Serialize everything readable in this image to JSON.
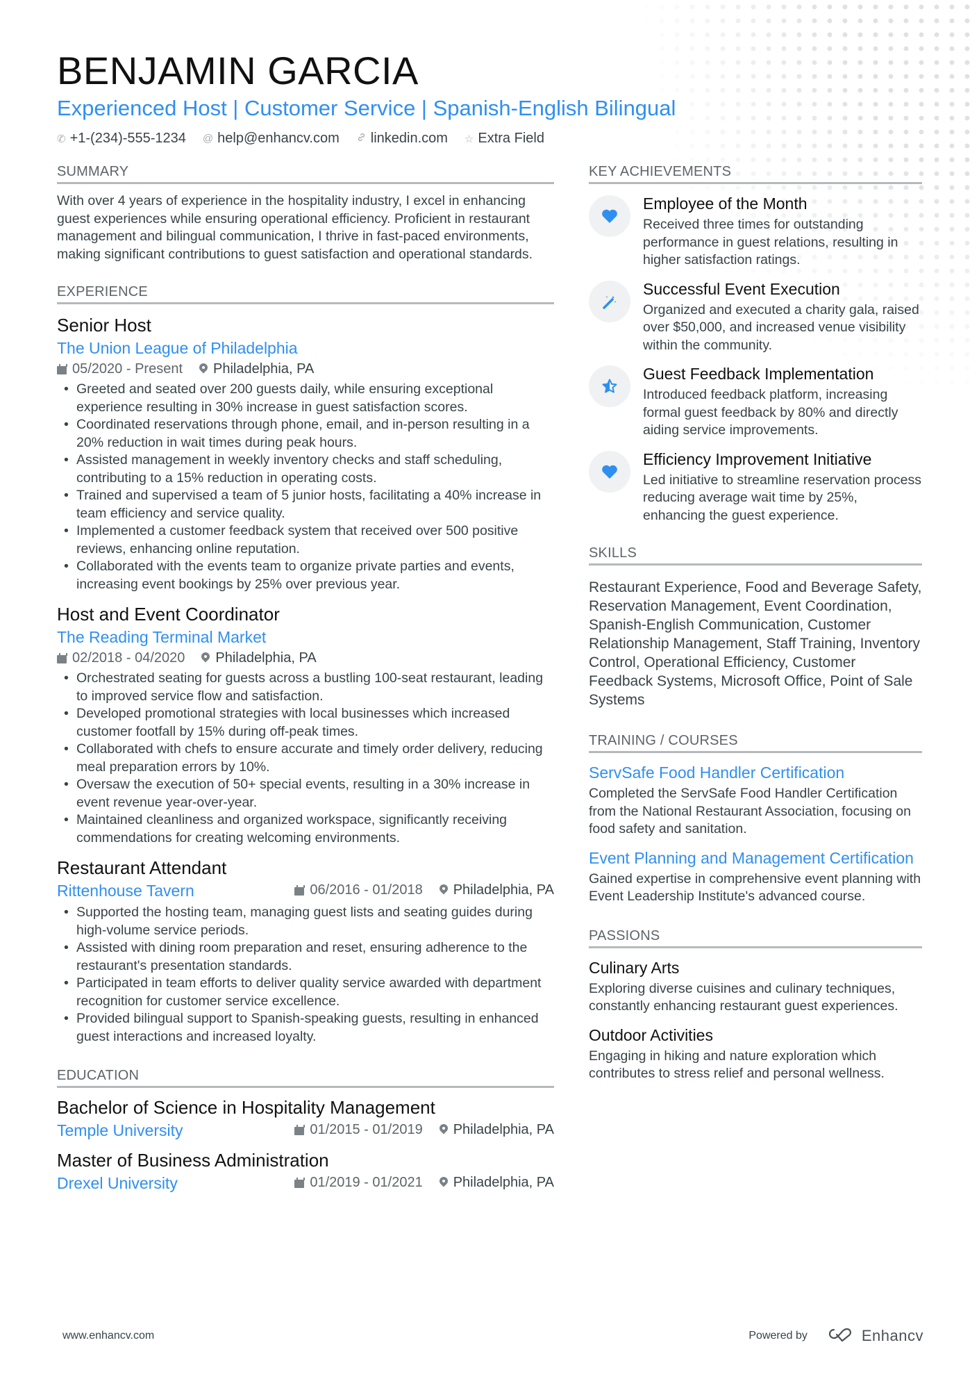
{
  "header": {
    "name": "BENJAMIN GARCIA",
    "title": "Experienced Host | Customer Service | Spanish-English Bilingual",
    "contacts": [
      {
        "icon": "phone-icon",
        "glyph": "✆",
        "text": "+1-(234)-555-1234"
      },
      {
        "icon": "at-icon",
        "glyph": "@",
        "text": "help@enhancv.com"
      },
      {
        "icon": "link-icon",
        "glyph": "🔗︎",
        "text": "linkedin.com"
      },
      {
        "icon": "star-icon",
        "glyph": "☆",
        "text": "Extra Field"
      }
    ]
  },
  "summary": {
    "heading": "SUMMARY",
    "text": "With over 4 years of experience in the hospitality industry, I excel in enhancing guest experiences while ensuring operational efficiency. Proficient in restaurant management and bilingual communication, I thrive in fast-paced environments, making significant contributions to guest satisfaction and operational standards."
  },
  "experience": {
    "heading": "EXPERIENCE",
    "jobs": [
      {
        "title": "Senior Host",
        "company": "The Union League of Philadelphia",
        "dates": "05/2020 - Present",
        "location": "Philadelphia, PA",
        "bullets": [
          "Greeted and seated over 200 guests daily, while ensuring exceptional experience resulting in 30% increase in guest satisfaction scores.",
          "Coordinated reservations through phone, email, and in-person resulting in a 20% reduction in wait times during peak hours.",
          "Assisted management in weekly inventory checks and staff scheduling, contributing to a 15% reduction in operating costs.",
          "Trained and supervised a team of 5 junior hosts, facilitating a 40% increase in team efficiency and service quality.",
          "Implemented a customer feedback system that received over 500 positive reviews, enhancing online reputation.",
          "Collaborated with the events team to organize private parties and events, increasing event bookings by 25% over previous year."
        ]
      },
      {
        "title": "Host and Event Coordinator",
        "company": "The Reading Terminal Market",
        "dates": "02/2018 - 04/2020",
        "location": "Philadelphia, PA",
        "bullets": [
          "Orchestrated seating for guests across a bustling 100-seat restaurant, leading to improved service flow and satisfaction.",
          "Developed promotional strategies with local businesses which increased customer footfall by 15% during off-peak times.",
          "Collaborated with chefs to ensure accurate and timely order delivery, reducing meal preparation errors by 10%.",
          "Oversaw the execution of 50+ special events, resulting in a 30% increase in event revenue year-over-year.",
          "Maintained cleanliness and organized workspace, significantly receiving commendations for creating welcoming environments."
        ]
      },
      {
        "title": "Restaurant Attendant",
        "company": "Rittenhouse Tavern",
        "dates": "06/2016 - 01/2018",
        "location": "Philadelphia, PA",
        "bullets": [
          "Supported the hosting team, managing guest lists and seating guides during high-volume service periods.",
          "Assisted with dining room preparation and reset, ensuring adherence to the restaurant's presentation standards.",
          "Participated in team efforts to deliver quality service awarded with department recognition for customer service excellence.",
          "Provided bilingual support to Spanish-speaking guests, resulting in enhanced guest interactions and increased loyalty."
        ]
      }
    ]
  },
  "education": {
    "heading": "EDUCATION",
    "items": [
      {
        "degree": "Bachelor of Science in Hospitality Management",
        "school": "Temple University",
        "dates": "01/2015 - 01/2019",
        "location": "Philadelphia, PA"
      },
      {
        "degree": "Master of Business Administration",
        "school": "Drexel University",
        "dates": "01/2019 - 01/2021",
        "location": "Philadelphia, PA"
      }
    ]
  },
  "achievements": {
    "heading": "KEY ACHIEVEMENTS",
    "items": [
      {
        "icon": "heart-icon",
        "glyph": "♥",
        "title": "Employee of the Month",
        "desc": "Received three times for outstanding performance in guest relations, resulting in higher satisfaction ratings."
      },
      {
        "icon": "magic-wand-icon",
        "glyph": "✎",
        "title": "Successful Event Execution",
        "desc": "Organized and executed a charity gala, raised over $50,000, and increased venue visibility within the community."
      },
      {
        "icon": "half-star-icon",
        "glyph": "☆",
        "title": "Guest Feedback Implementation",
        "desc": "Introduced feedback platform, increasing formal guest feedback by 80% and directly aiding service improvements."
      },
      {
        "icon": "heart-icon",
        "glyph": "♥",
        "title": "Efficiency Improvement Initiative",
        "desc": "Led initiative to streamline reservation process reducing average wait time by 25%, enhancing the guest experience."
      }
    ]
  },
  "skills": {
    "heading": "SKILLS",
    "text": "Restaurant Experience, Food and Beverage Safety, Reservation Management, Event Coordination, Spanish-English Communication, Customer Relationship Management, Staff Training, Inventory Control, Operational Efficiency, Customer Feedback Systems, Microsoft Office, Point of Sale Systems"
  },
  "training": {
    "heading": "TRAINING / COURSES",
    "items": [
      {
        "title": "ServSafe Food Handler Certification",
        "desc": "Completed the ServSafe Food Handler Certification from the National Restaurant Association, focusing on food safety and sanitation."
      },
      {
        "title": "Event Planning and Management Certification",
        "desc": "Gained expertise in comprehensive event planning with Event Leadership Institute's advanced course."
      }
    ]
  },
  "passions": {
    "heading": "PASSIONS",
    "items": [
      {
        "title": "Culinary Arts",
        "desc": "Exploring diverse cuisines and culinary techniques, constantly enhancing restaurant guest experiences."
      },
      {
        "title": "Outdoor Activities",
        "desc": "Engaging in hiking and nature exploration which contributes to stress relief and personal wellness."
      }
    ]
  },
  "footer": {
    "website": "www.enhancv.com",
    "powered_by": "Powered by",
    "brand": "Enhancv"
  },
  "colors": {
    "accent": "#2f8ff0",
    "text": "#384347",
    "heading": "#111111",
    "rule": "#b6b9bc"
  }
}
